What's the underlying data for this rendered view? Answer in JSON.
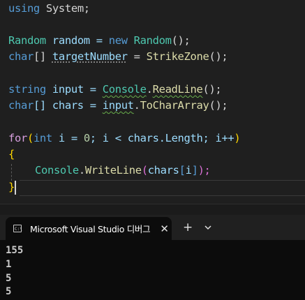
{
  "editor": {
    "l1": {
      "a": "using",
      "b": " System;"
    },
    "l2": {
      "a": "Random",
      "b": " random = ",
      "c": "new",
      "d": " ",
      "e": "Random",
      "f": "();"
    },
    "l3": {
      "a": "char",
      "b": "[] ",
      "c": "targetNumber",
      "d": " = ",
      "e": "StrikeZone",
      "f": "();"
    },
    "l4": {
      "a": "string",
      "b": " input = ",
      "c": "Console",
      "d": ".",
      "e": "ReadLine",
      "f": "();"
    },
    "l5": {
      "a": "char",
      "b": "[] chars = ",
      "c": "input",
      "d": ".",
      "e": "ToCharArray",
      "f": "();"
    },
    "l6": {
      "a": "for",
      "b": "(",
      "c": "int",
      "d": " i = ",
      "e": "0",
      "f": "; i < chars.",
      "g": "Length",
      "h": "; i++",
      "i": ")"
    },
    "l7": {
      "a": "{"
    },
    "l8": {
      "a": "Console",
      "b": ".",
      "c": "WriteLine",
      "d": "(",
      "e": "chars",
      "f": "[",
      "g": "i",
      "h": "]",
      "i": ");"
    },
    "l9": {
      "a": "}"
    }
  },
  "terminal": {
    "tab_title": "Microsoft Visual Studio 디버그",
    "tab_icon": "terminal-icon",
    "close_label": "✕",
    "new_tab_label": "+",
    "output": [
      "155",
      "1",
      "5",
      "5"
    ]
  },
  "colors": {
    "keyword": "#569cd6",
    "type": "#4ec9b0",
    "identifier": "#9cdcfe",
    "method": "#dcdcaa",
    "control": "#d8a0df",
    "number": "#b5cea8"
  }
}
